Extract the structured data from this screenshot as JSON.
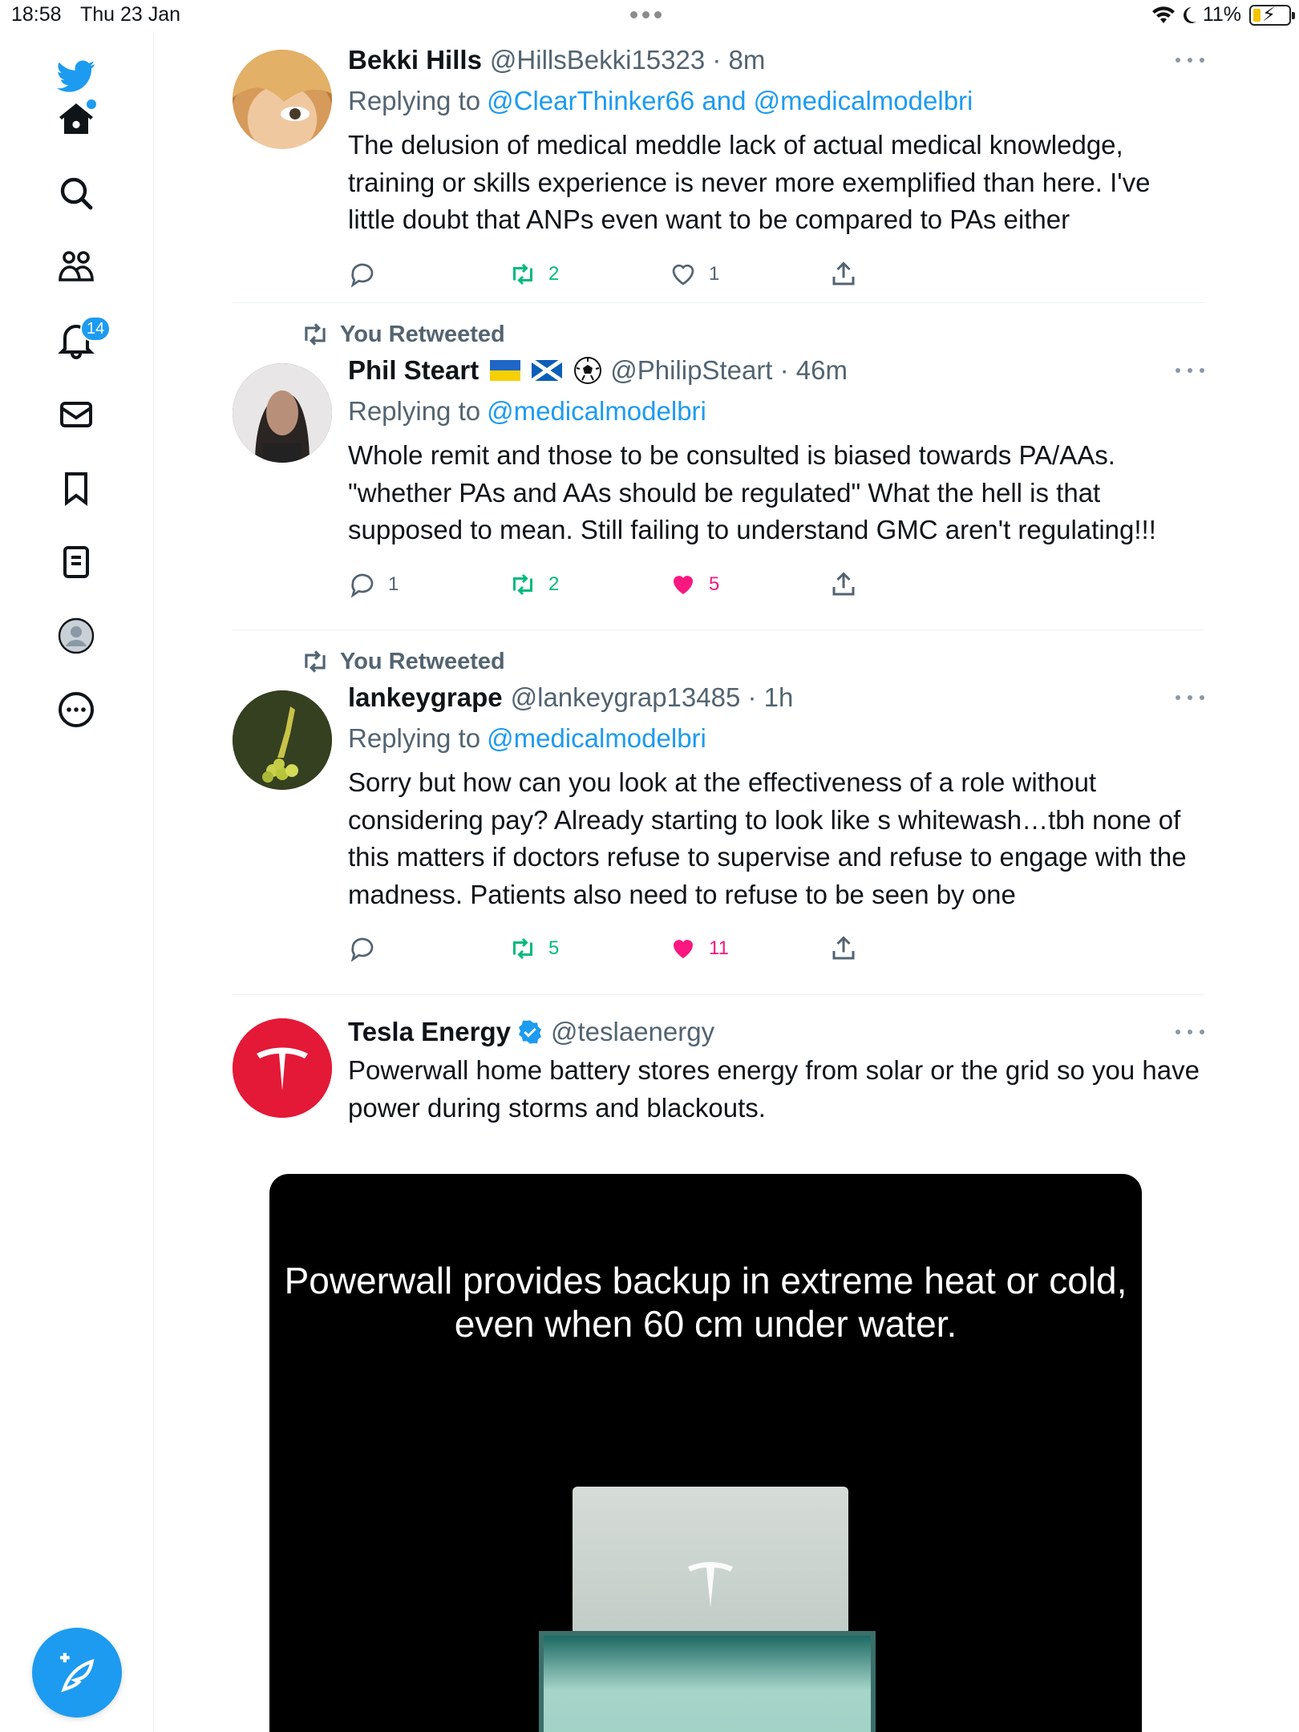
{
  "status_bar": {
    "time": "18:58",
    "date": "Thu 23 Jan",
    "battery": "11%"
  },
  "sidebar": {
    "notifications_badge": "14",
    "items": [
      "twitter-logo",
      "home",
      "search",
      "communities",
      "notifications",
      "messages",
      "bookmarks",
      "lists",
      "profile",
      "more"
    ]
  },
  "tweets": [
    {
      "name": "Bekki Hills",
      "handle": "@HillsBekki15323 · 8m",
      "replying_prefix": "Replying to",
      "replying_to": "@ClearThinker66 and @medicalmodelbri",
      "text": "The delusion of medical meddle lack of actual medical knowledge, training or skills experience is never more exemplified than here. I've little doubt that ANPs even want to be compared to PAs either",
      "replies": "",
      "retweets": "2",
      "likes": "1"
    },
    {
      "retweeted_label": "You Retweeted",
      "name": "Phil Steart",
      "handle": "@PhilipSteart · 46m",
      "replying_prefix": "Replying to",
      "replying_to": "@medicalmodelbri",
      "text": "Whole remit and those to be consulted is biased towards PA/AAs. \"whether PAs and AAs should be regulated\" What the hell is that supposed to mean. Still failing to understand GMC aren't regulating!!!",
      "replies": "1",
      "retweets": "2",
      "likes": "5"
    },
    {
      "retweeted_label": "You Retweeted",
      "name": "lankeygrape",
      "handle": "@lankeygrap13485 · 1h",
      "replying_prefix": "Replying to",
      "replying_to": "@medicalmodelbri",
      "text": "Sorry but how can you look at the effectiveness of a role without considering pay? Already starting to look like s whitewash…tbh none of this matters if doctors refuse to supervise and refuse to engage with the madness. Patients also need to refuse to be seen by one",
      "replies": "",
      "retweets": "5",
      "likes": "11"
    },
    {
      "name": "Tesla Energy",
      "handle": "@teslaenergy",
      "text": "Powerwall home battery stores energy from solar or the grid so you have power during storms and blackouts.",
      "media_caption": "Powerwall provides backup in extreme heat or cold, even when 60 cm under water."
    }
  ],
  "colors": {
    "accent": "#1d9bf0",
    "retweet": "#00ba7c",
    "like": "#f91880",
    "muted": "#536471"
  }
}
